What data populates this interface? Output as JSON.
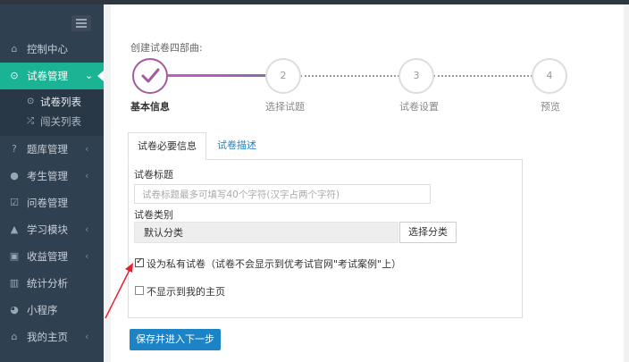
{
  "colors": {
    "sidebar_bg": "#2f4050",
    "active_green": "#1ab394",
    "step_done": "#a45a9f",
    "primary_blue": "#1c84c6",
    "annotation_red": "#e8202a"
  },
  "sidebar": {
    "items": [
      {
        "icon": "home-icon",
        "label": "控制中心"
      },
      {
        "icon": "check-circle-icon",
        "label": "试卷管理",
        "active": true
      },
      {
        "icon": "help-circle-icon",
        "label": "题库管理"
      },
      {
        "icon": "user-icon",
        "label": "考生管理"
      },
      {
        "icon": "checkbox-icon",
        "label": "问卷管理"
      },
      {
        "icon": "graduation-cap-icon",
        "label": "学习模块"
      },
      {
        "icon": "money-icon",
        "label": "收益管理"
      },
      {
        "icon": "bar-chart-icon",
        "label": "统计分析"
      },
      {
        "icon": "wechat-icon",
        "label": "小程序"
      },
      {
        "icon": "home-icon",
        "label": "我的主页"
      }
    ],
    "subitems": [
      {
        "icon": "check-circle-icon",
        "label": "试卷列表",
        "selected": true
      },
      {
        "icon": "shuffle-icon",
        "label": "闯关列表"
      }
    ]
  },
  "wizard": {
    "heading": "创建试卷四部曲:",
    "steps": [
      {
        "num": "",
        "label": "基本信息",
        "done": true
      },
      {
        "num": "2",
        "label": "选择试题"
      },
      {
        "num": "3",
        "label": "试卷设置"
      },
      {
        "num": "4",
        "label": "预览"
      }
    ]
  },
  "tabs": {
    "active": "试卷必要信息",
    "other": "试卷描述"
  },
  "form": {
    "title_label": "试卷标题",
    "title_placeholder": "试卷标题最多可填写40个字符(汉字占两个字符)",
    "category_label": "试卷类别",
    "category_value": "默认分类",
    "category_button": "选择分类",
    "private_label": "设为私有试卷（试卷不会显示到优考试官网\"考试案例\"上）",
    "private_checked": true,
    "hide_label": "不显示到我的主页",
    "hide_checked": false
  },
  "save_button": "保存并进入下一步"
}
